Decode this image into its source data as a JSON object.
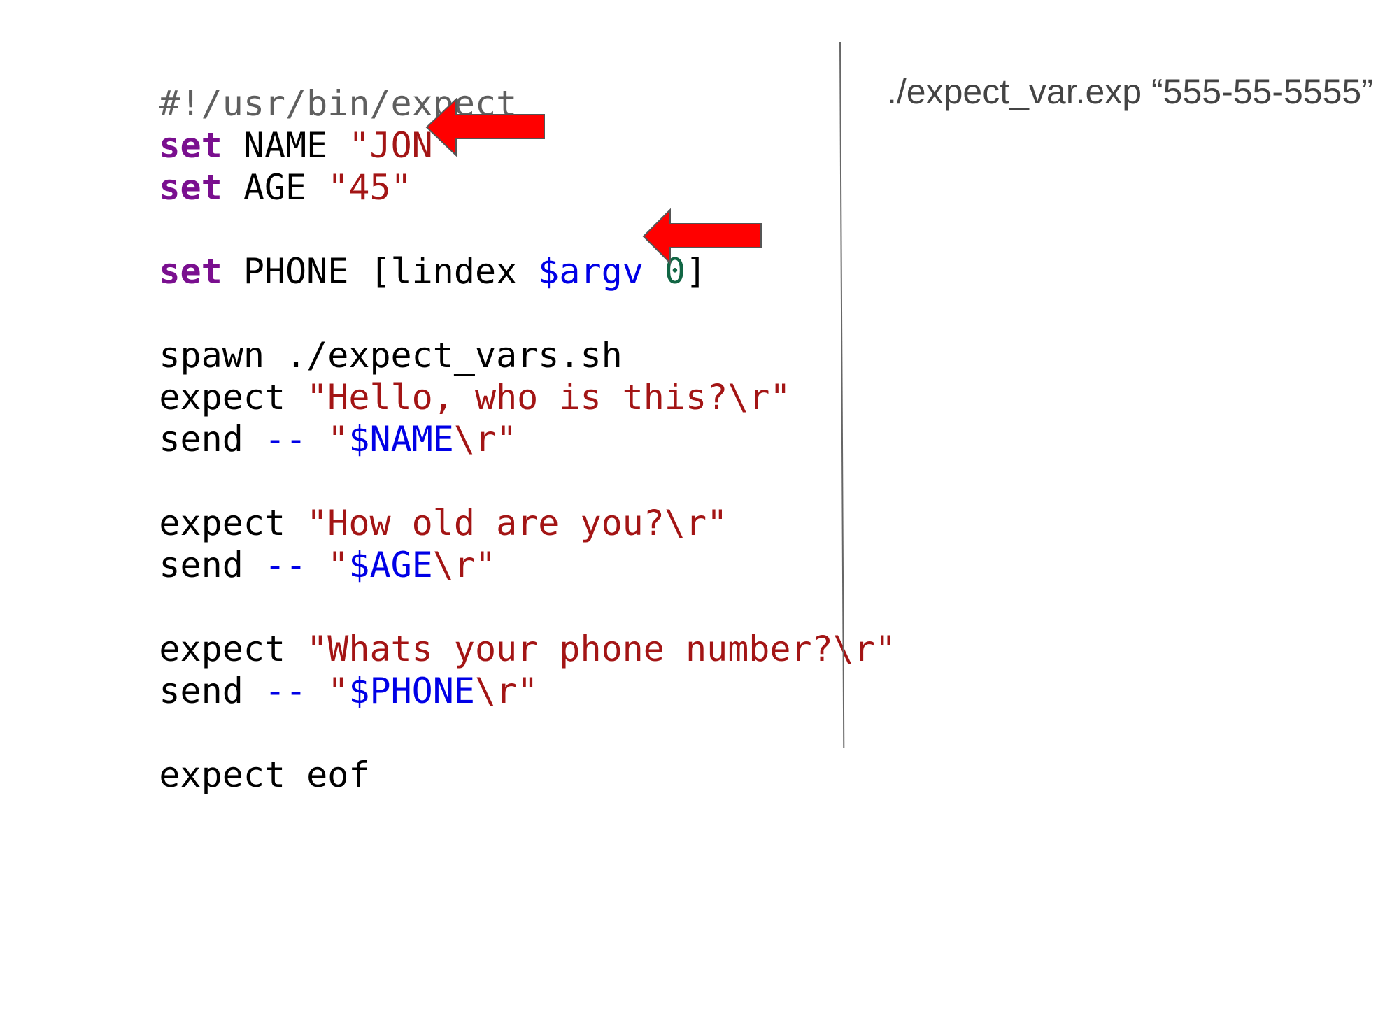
{
  "code": {
    "shebang": "#!/usr/bin/expect",
    "line_set_name": {
      "keyword": "set",
      "name": " NAME ",
      "value": "\"JON\""
    },
    "line_set_age": {
      "keyword": "set",
      "name": " AGE ",
      "value": "\"45\""
    },
    "line_set_phone": {
      "keyword": "set",
      "name": " PHONE [lindex ",
      "argv": "$argv",
      "space": " ",
      "index": "0",
      "close": "]"
    },
    "line_spawn": "spawn ./expect_vars.sh",
    "line_expect_hello": {
      "cmd": "expect ",
      "str": "\"Hello, who is this?\\r\""
    },
    "line_send_name": {
      "cmd": "send ",
      "op": "--",
      "space": " ",
      "q1": "\"",
      "var": "$NAME",
      "rest": "\\r\""
    },
    "line_expect_age": {
      "cmd": "expect ",
      "str": "\"How old are you?\\r\""
    },
    "line_send_age": {
      "cmd": "send ",
      "op": "--",
      "space": " ",
      "q1": "\"",
      "var": "$AGE",
      "rest": "\\r\""
    },
    "line_expect_phone": {
      "cmd": "expect ",
      "str": "\"Whats your phone number?\\r\""
    },
    "line_send_phone": {
      "cmd": "send ",
      "op": "--",
      "space": " ",
      "q1": "\"",
      "var": "$PHONE",
      "rest": "\\r\""
    },
    "line_eof": "expect eof"
  },
  "command": {
    "text": "./expect_var.exp “555-55-5555”"
  },
  "colors": {
    "keyword": "#7a0f8f",
    "string": "#a31515",
    "variable": "#0000e6",
    "number": "#116644",
    "comment": "#5f5f5f",
    "arrow_fill": "#ff0000",
    "arrow_stroke": "#555555",
    "divider": "#666666"
  },
  "icons": {
    "arrow_1": "left-arrow",
    "arrow_2": "left-arrow"
  }
}
